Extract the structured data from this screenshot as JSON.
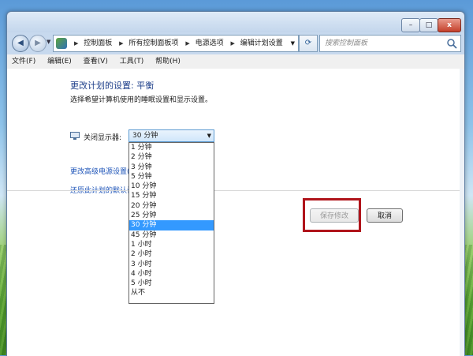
{
  "window": {
    "min_icon": "–",
    "max_icon": "□",
    "close_icon": "x"
  },
  "nav": {
    "breadcrumbs": [
      "控制面板",
      "所有控制面板项",
      "电源选项",
      "编辑计划设置"
    ],
    "search_placeholder": "搜索控制面板"
  },
  "menu": [
    "文件(F)",
    "编辑(E)",
    "查看(V)",
    "工具(T)",
    "帮助(H)"
  ],
  "page": {
    "heading": "更改计划的设置: 平衡",
    "description": "选择希望计算机使用的睡眠设置和显示设置。",
    "display_label": "关闭显示器:",
    "display_value": "30 分钟",
    "link_advanced": "更改高级电源设置(C",
    "link_restore": "还原此计划的默认设"
  },
  "dropdown": {
    "options": [
      "1 分钟",
      "2 分钟",
      "3 分钟",
      "5 分钟",
      "10 分钟",
      "15 分钟",
      "20 分钟",
      "25 分钟",
      "30 分钟",
      "45 分钟",
      "1 小时",
      "2 小时",
      "3 小时",
      "4 小时",
      "5 小时",
      "从不"
    ],
    "selected_index": 8
  },
  "buttons": {
    "save": "保存修改",
    "cancel": "取消"
  },
  "colors": {
    "highlight_box": "#b0141b",
    "selected_option": "#3399ff",
    "heading": "#1e3f8a",
    "link": "#1e54b8"
  }
}
